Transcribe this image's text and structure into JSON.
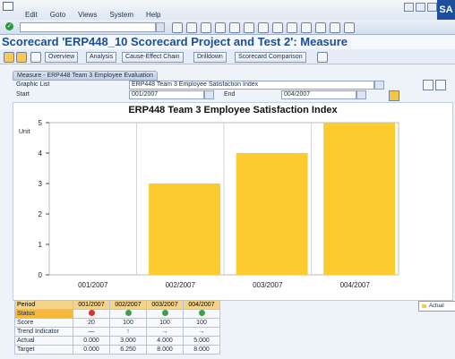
{
  "menu": [
    "Edit",
    "Goto",
    "Views",
    "System",
    "Help"
  ],
  "window": {
    "brand": "SA"
  },
  "title": "Scorecard 'ERP448_10 Scorecard Project and Test 2': Measure",
  "app_toolbar": [
    "Overview",
    "Analysis",
    "Cause-Effect Chain",
    "Drilldown",
    "Scorecard Comparison"
  ],
  "form": {
    "group_title": "Measure - ERP448 Team 3 Employee Evaluation",
    "graphic_list_label": "Graphic List",
    "graphic_list_value": "ERP448 Team 3 Employee Satisfaction Index",
    "start_label": "Start",
    "start_value": "001/2007",
    "end_label": "End",
    "end_value": "004/2007"
  },
  "chart_data": {
    "type": "bar",
    "title": "ERP448 Team 3 Employee Satisfaction Index",
    "ylabel": "Unit",
    "categories": [
      "001/2007",
      "002/2007",
      "003/2007",
      "004/2007"
    ],
    "series": [
      {
        "name": "Actual",
        "values": [
          0,
          3,
          4,
          5
        ]
      }
    ],
    "ylim": [
      0,
      5
    ],
    "yticks": [
      "0",
      "1",
      "2",
      "3",
      "4",
      "5"
    ],
    "legend": "right",
    "colors": {
      "bar": "#fccb2f"
    }
  },
  "table": {
    "header_label": "Period",
    "periods": [
      "001/2007",
      "002/2007",
      "003/2007",
      "004/2007"
    ],
    "rows": [
      {
        "label": "Status",
        "values": [
          "",
          "",
          "",
          ""
        ],
        "status": [
          "red",
          "green",
          "green",
          "green"
        ]
      },
      {
        "label": "Score",
        "values": [
          "20",
          "100",
          "100",
          "100"
        ]
      },
      {
        "label": "Trend Indicator",
        "values": [
          "—",
          "↑",
          "→",
          "→"
        ]
      },
      {
        "label": "Actual",
        "values": [
          "0.000",
          "3.000",
          "4.000",
          "5.000"
        ]
      },
      {
        "label": "Target",
        "values": [
          "0.000",
          "6.250",
          "8.000",
          "8.000"
        ]
      }
    ]
  }
}
